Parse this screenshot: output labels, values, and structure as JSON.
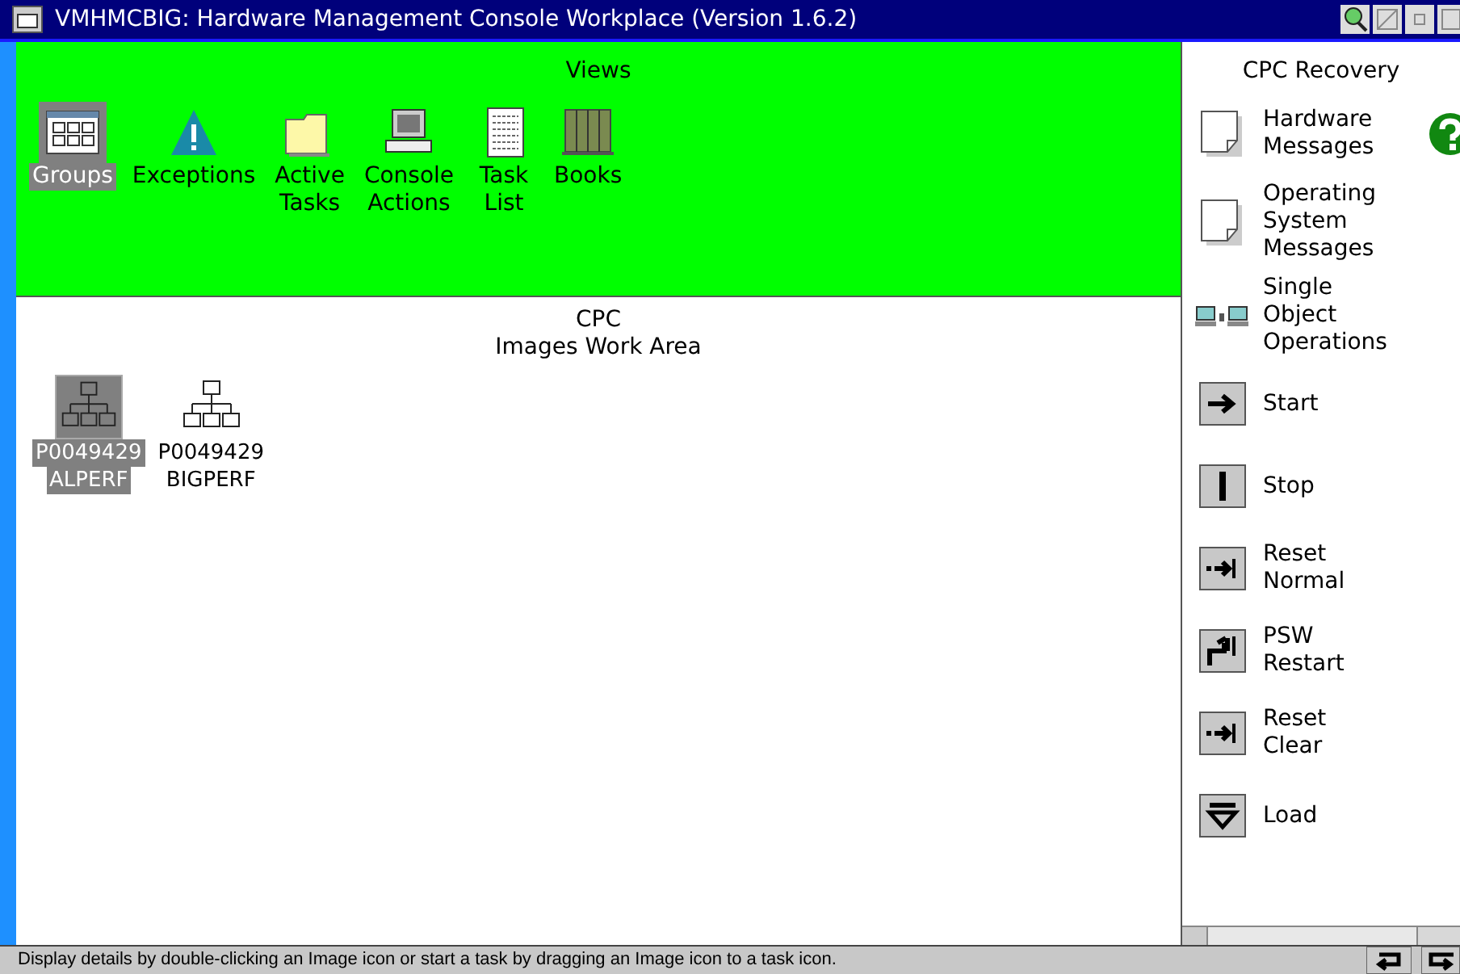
{
  "window": {
    "title": "VMHMCBIG: Hardware Management Console Workplace (Version 1.6.2)"
  },
  "views": {
    "title": "Views",
    "items": [
      {
        "kind": "groups",
        "label": "Groups",
        "selected": true
      },
      {
        "kind": "warning",
        "label": "Exceptions",
        "selected": false
      },
      {
        "kind": "folder",
        "label": "Active Tasks",
        "selected": false
      },
      {
        "kind": "console",
        "label": "Console Actions",
        "selected": false
      },
      {
        "kind": "list",
        "label": "Task List",
        "selected": false
      },
      {
        "kind": "books",
        "label": "Books",
        "selected": false
      }
    ]
  },
  "work_area": {
    "title": "CPC",
    "subtitle": "Images Work Area",
    "items": [
      {
        "label": "P0049429",
        "sublabel": "ALPERF",
        "selected": true
      },
      {
        "label": "P0049429",
        "sublabel": "BIGPERF",
        "selected": false
      }
    ]
  },
  "tasks": {
    "title": "CPC Recovery",
    "items": [
      {
        "kind": "document",
        "label": "Hardware Messages"
      },
      {
        "kind": "document",
        "label": "Operating System Messages"
      },
      {
        "kind": "computers",
        "label": "Single Object Operations"
      },
      {
        "kind": "start",
        "label": "Start"
      },
      {
        "kind": "stop",
        "label": "Stop"
      },
      {
        "kind": "reset",
        "label": "Reset Normal"
      },
      {
        "kind": "psw",
        "label": "PSW Restart"
      },
      {
        "kind": "reset",
        "label": "Reset Clear"
      },
      {
        "kind": "load",
        "label": "Load"
      }
    ]
  },
  "status_bar": {
    "text": "Display details by double-clicking an Image icon or start a task by dragging an Image icon to a task icon."
  }
}
